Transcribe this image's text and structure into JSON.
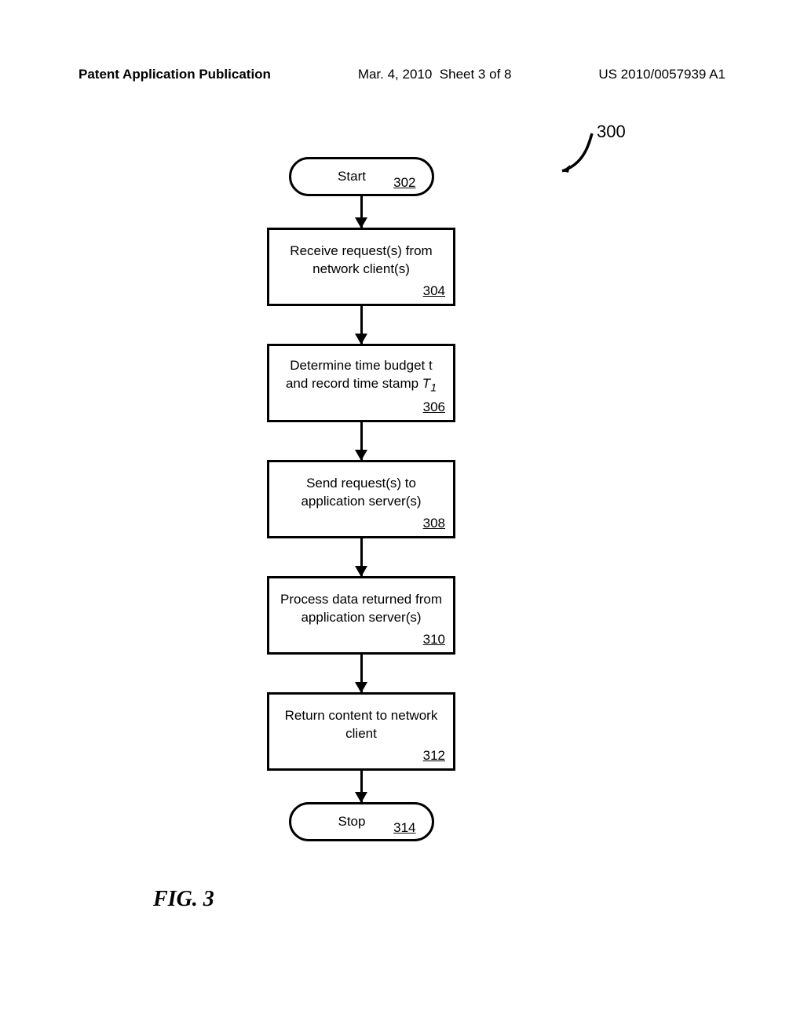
{
  "header": {
    "publication_label": "Patent Application Publication",
    "date": "Mar. 4, 2010",
    "sheet": "Sheet 3 of 8",
    "pub_no": "US 2010/0057939 A1"
  },
  "reference": "300",
  "steps": {
    "start": {
      "label": "Start",
      "num": "302"
    },
    "s1": {
      "text": "Receive request(s) from network client(s)",
      "num": "304"
    },
    "s2": {
      "text_a": "Determine time budget t and record time stamp ",
      "text_b": "T",
      "text_c": "1",
      "num": "306"
    },
    "s3": {
      "text": "Send request(s) to application server(s)",
      "num": "308"
    },
    "s4": {
      "text": "Process data returned from application server(s)",
      "num": "310"
    },
    "s5": {
      "text": "Return content to network client",
      "num": "312"
    },
    "stop": {
      "label": "Stop",
      "num": "314"
    }
  },
  "figure_label": "FIG. 3"
}
